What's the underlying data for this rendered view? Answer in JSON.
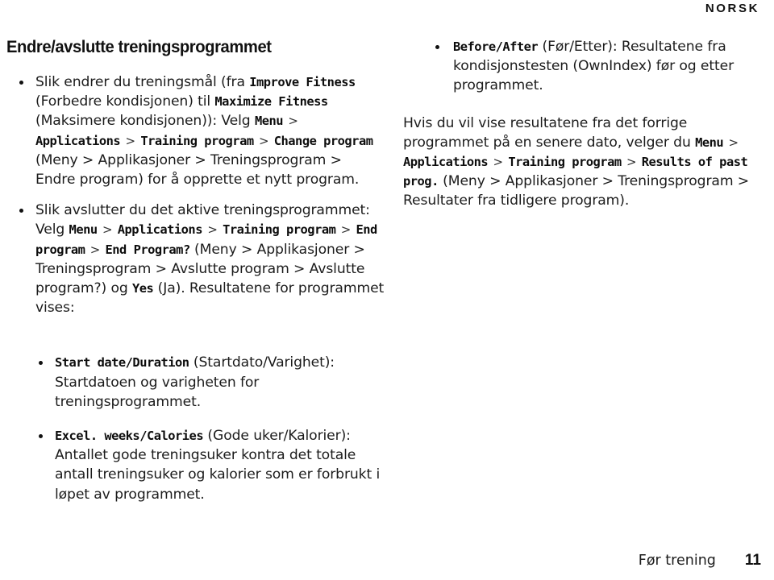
{
  "running_header": {
    "text": "NORSK"
  },
  "footer": {
    "label": "Før trening",
    "page_number": "11"
  },
  "left_column": {
    "heading": "Endre/avslutte treningsprogrammet",
    "bullet1": {
      "seg1": "Slik endrer du treningsmål (fra ",
      "ui1": "Improve Fitness",
      "seg2": " (Forbedre kondisjonen) til ",
      "ui2": "Maximize Fitness",
      "seg3": " (Maksimere kondisjonen)): Velg ",
      "ui3": "Menu",
      "arrow1": ">",
      "ui4": "Applications",
      "arrow2": ">",
      "ui5": "Training program",
      "arrow3": ">",
      "ui6": "Change program",
      "seg4": " (Meny > Applikasjoner > Treningsprogram > Endre program) for å opprette et nytt program."
    },
    "bullet2": {
      "seg1": "Slik avslutter du det aktive treningsprogrammet: Velg ",
      "ui1": "Menu",
      "arrow1": ">",
      "ui2": "Applications",
      "arrow2": ">",
      "ui3": "Training program",
      "arrow3": ">",
      "ui4": "End program",
      "arrow4": ">",
      "ui5": "End Program?",
      "seg2": " (Meny > Applikasjoner > Treningsprogram > Avslutte program > Avslutte program?) og ",
      "ui6": "Yes",
      "seg3": " (Ja). Resultatene for programmet vises:"
    },
    "bullet3": {
      "ui1": "Start date/Duration",
      "seg1": " (Startdato/Varighet): Startdatoen og varigheten for treningsprogrammet."
    },
    "bullet4": {
      "ui1": "Excel. weeks/Calories",
      "seg1": " (Gode uker/Kalorier): Antallet gode treningsuker kontra det totale antall treningsuker og kalorier som er forbrukt i løpet av programmet."
    }
  },
  "right_column": {
    "bullet1": {
      "ui1": "Before/After",
      "seg1": " (Før/Etter): Resultatene fra kondisjonstesten (OwnIndex) før og etter programmet."
    },
    "para1": {
      "seg1": "Hvis du vil vise resultatene fra det forrige programmet på en senere dato, velger du ",
      "ui1": "Menu",
      "arrow1": ">",
      "ui2": "Applications",
      "arrow2": ">",
      "ui3": "Training program",
      "arrow3": ">",
      "ui4": "Results of past prog.",
      "seg2": " (Meny > Applikasjoner > Treningsprogram > Resultater fra tidligere program)."
    }
  }
}
